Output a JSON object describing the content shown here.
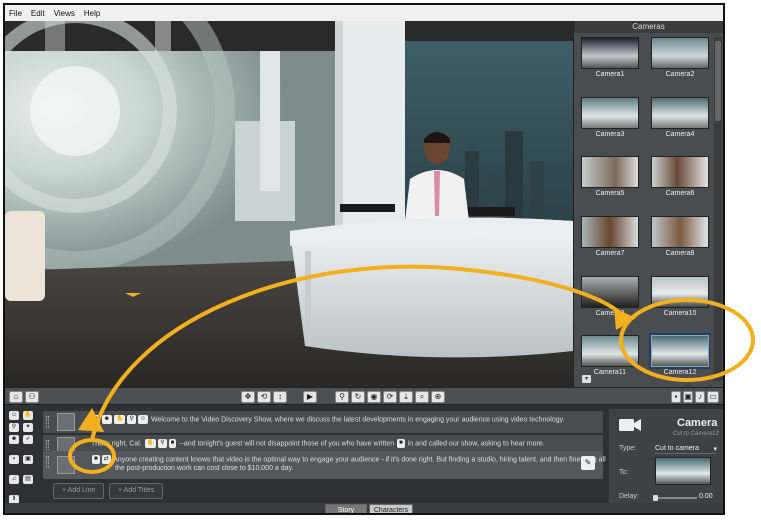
{
  "menu": [
    "File",
    "Edit",
    "Views",
    "Help"
  ],
  "cameras": {
    "title": "Cameras",
    "items": [
      "Camera1",
      "Camera2",
      "Camera3",
      "Camera4",
      "Camera5",
      "Camera6",
      "Camera7",
      "Camera8",
      "Camera9",
      "Camera10",
      "Camera11",
      "Camera12"
    ],
    "selected": "Camera12"
  },
  "story": {
    "rows": [
      {
        "text": "Welcome to the Video Discovery Show, where we discuss the latest developments in engaging your audience using video technology."
      },
      {
        "text_a": "That's right, Cal.",
        "text_b": "--and tonight's guest will not disappoint those of you who have written",
        "text_c": "in and called our show, asking to hear more."
      },
      {
        "line1": "Anyone creating content knows that video is the optimal way to engage your audience - if it's done right. But finding a studio, hiring talent, and then finessing all",
        "line2": "the post-production work can cost close to $10,000 a day."
      }
    ],
    "add_line": "+ Add Line",
    "add_titles": "+ Add Titles"
  },
  "properties": {
    "title": "Camera",
    "subtitle": "Cut to Camera12",
    "type_label": "Type:",
    "type_value": "Cut to camera",
    "to_label": "To:",
    "delay_label": "Delay:",
    "delay_value": "0.00"
  },
  "tabs": [
    "Story",
    "Characters"
  ],
  "colors": {
    "annotation": "#f2b01e",
    "accent_select": "#2b3b5c"
  }
}
